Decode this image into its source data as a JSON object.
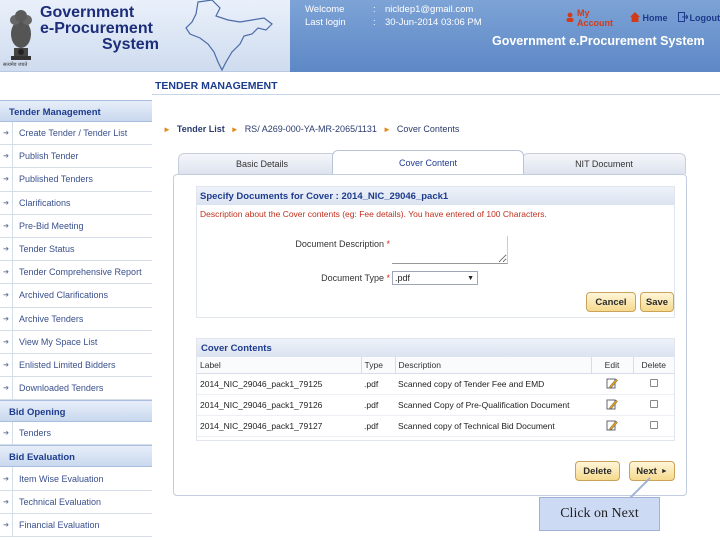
{
  "header": {
    "logo_lines": [
      "Government",
      "e-Procurement",
      "System"
    ],
    "emblem_caption": "सत्यमेव जयते",
    "welcome_label": "Welcome",
    "welcome_value": "nicldep1@gmail.com",
    "last_login_label": "Last login",
    "last_login_value": "30-Jun-2014 03:06 PM",
    "separator": ":",
    "links": {
      "account": "My Account",
      "home": "Home",
      "logout": "Logout"
    },
    "site_title": "Government e.Procurement System"
  },
  "section_title": "TENDER MANAGEMENT",
  "sidebar": {
    "groups": [
      {
        "title": "Tender Management",
        "items": [
          "Create Tender / Tender List",
          "Publish Tender",
          "Published Tenders",
          "Clarifications",
          "Pre-Bid Meeting",
          "Tender Status",
          "Tender Comprehensive Report",
          "Archived Clarifications",
          "Archive Tenders",
          "View My Space List",
          "Enlisted Limited Bidders",
          "Downloaded Tenders"
        ]
      },
      {
        "title": "Bid Opening",
        "items": [
          "Tenders"
        ]
      },
      {
        "title": "Bid Evaluation",
        "items": [
          "Item Wise Evaluation",
          "Technical Evaluation",
          "Financial Evaluation"
        ]
      }
    ]
  },
  "breadcrumb": [
    "Tender List",
    "RS/ A269-000-YA-MR-2065/1131",
    "Cover Contents"
  ],
  "tabs": [
    "Basic Details",
    "Cover Content",
    "NIT Document"
  ],
  "form": {
    "title": "Specify Documents for Cover : 2014_NIC_29046_pack1",
    "description": "Description about the Cover contents (eg: Fee details). You have entered  of 100 Characters.",
    "doc_desc_label": "Document Description",
    "doc_type_label": "Document Type",
    "required_mark": "*",
    "doc_type_value": ".pdf",
    "cancel_label": "Cancel",
    "save_label": "Save"
  },
  "cover": {
    "title": "Cover Contents",
    "columns": [
      "Label",
      "Type",
      "Description",
      "Edit",
      "Delete"
    ],
    "rows": [
      {
        "label": "2014_NIC_29046_pack1_79125",
        "type": ".pdf",
        "description": "Scanned copy of Tender Fee and EMD"
      },
      {
        "label": "2014_NIC_29046_pack1_79126",
        "type": ".pdf",
        "description": "Scanned Copy of Pre-Qualification Document"
      },
      {
        "label": "2014_NIC_29046_pack1_79127",
        "type": ".pdf",
        "description": "Scanned copy of Technical Bid Document"
      }
    ],
    "delete_label": "Delete",
    "next_label": "Next"
  },
  "callout": "Click on Next",
  "colors": {
    "brand_blue": "#1e3c8e",
    "header_blue": "#5d88c6",
    "alert_red": "#c0301e",
    "button_gold": "#f5d98d"
  }
}
